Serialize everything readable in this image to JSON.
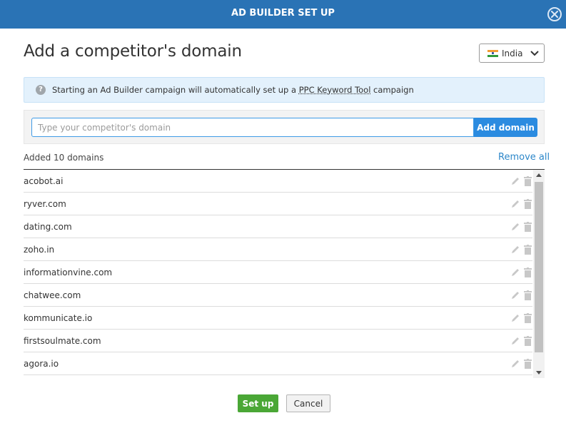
{
  "header": {
    "title": "AD BUILDER SET UP",
    "close_icon": "close-icon",
    "color": "#2a73b5"
  },
  "page_title": "Add a competitor's domain",
  "country": {
    "label": "India",
    "flag_icon": "india-flag-icon"
  },
  "info": {
    "text_before": "Starting an Ad Builder campaign will automatically set up a ",
    "link": "PPC Keyword Tool",
    "text_after": " campaign"
  },
  "domain_input": {
    "placeholder": "Type your competitor's domain",
    "value": ""
  },
  "add_button": "Add domain",
  "added_count": "Added 10 domains",
  "remove_all": "Remove all",
  "domains": [
    "acobot.ai",
    "ryver.com",
    "dating.com",
    "zoho.in",
    "informationvine.com",
    "chatwee.com",
    "kommunicate.io",
    "firstsoulmate.com",
    "agora.io"
  ],
  "footer": {
    "setup_label": "Set up",
    "cancel_label": "Cancel",
    "setup_color": "#4aa736"
  }
}
